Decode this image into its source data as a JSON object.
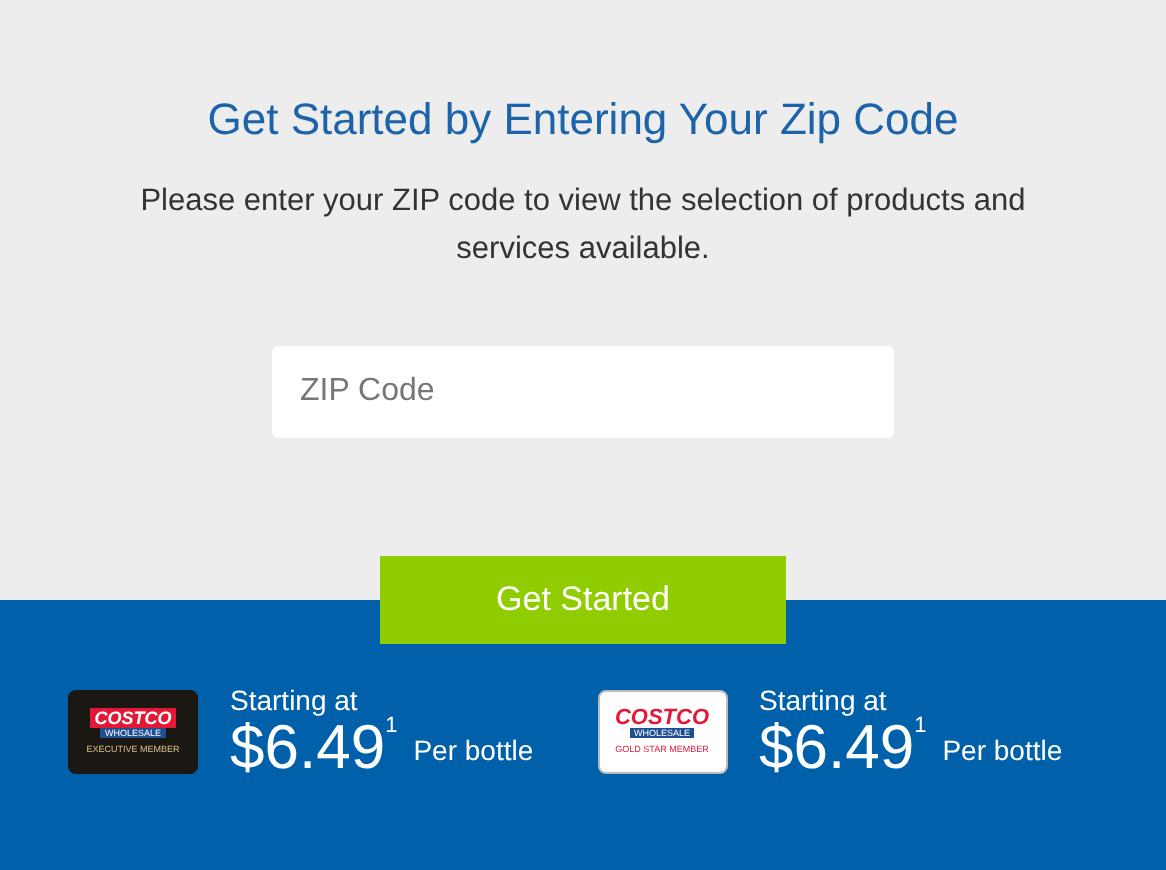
{
  "heading": "Get Started by Entering Your Zip Code",
  "intro": "Please enter your ZIP code to view the selection of products and services available.",
  "zip_field": {
    "placeholder": "ZIP Code"
  },
  "button": "Get Started",
  "offers": [
    {
      "card": {
        "kind": "executive",
        "brand": "COSTCO",
        "sub": "WHOLESALE",
        "tier": "EXECUTIVE MEMBER"
      },
      "lead": "Starting at",
      "price": "$6.49",
      "note": "1",
      "unit": "Per bottle"
    },
    {
      "card": {
        "kind": "gold",
        "brand": "COSTCO",
        "sub": "WHOLESALE",
        "tier": "GOLD STAR MEMBER"
      },
      "lead": "Starting at",
      "price": "$6.49",
      "note": "1",
      "unit": "Per bottle"
    }
  ]
}
